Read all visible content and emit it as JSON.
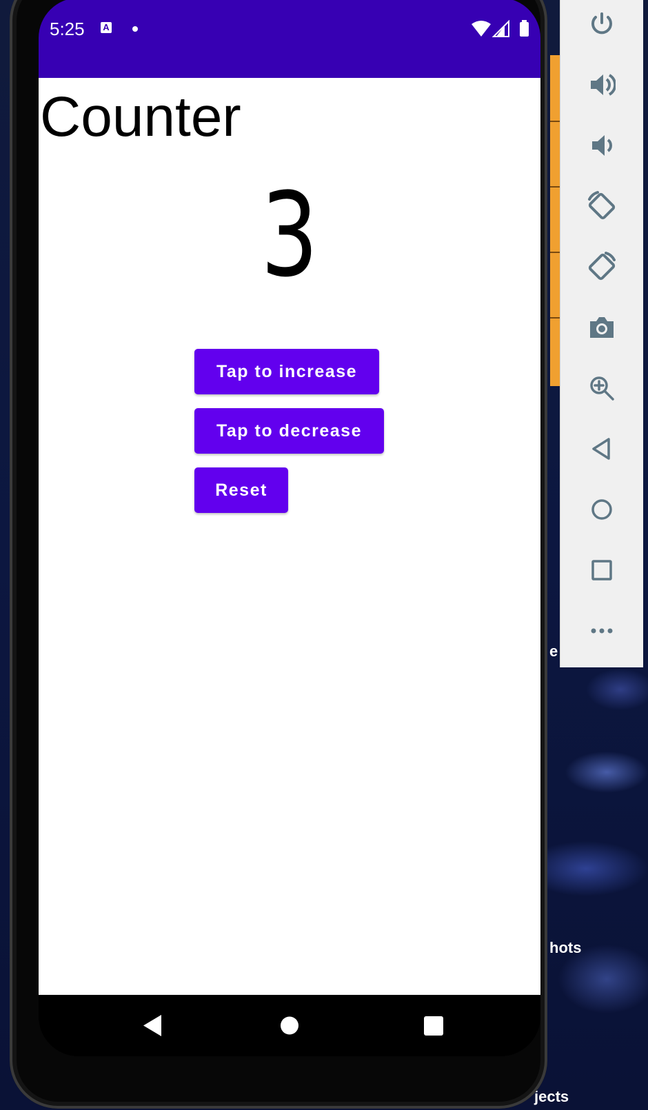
{
  "status_bar": {
    "time": "5:25",
    "notification_icon": "A",
    "icons": [
      "wifi-icon",
      "signal-icon",
      "battery-icon"
    ]
  },
  "app": {
    "title": "Counter",
    "count": "3",
    "buttons": {
      "increase": "Tap to increase",
      "decrease": "Tap to decrease",
      "reset": "Reset"
    }
  },
  "nav_bar": [
    "back-icon",
    "home-icon",
    "recents-icon"
  ],
  "emulator_toolbar": [
    "power-icon",
    "volume-up-icon",
    "volume-down-icon",
    "rotate-left-icon",
    "rotate-right-icon",
    "camera-icon",
    "zoom-icon",
    "back-icon",
    "home-icon",
    "overview-icon",
    "more-icon"
  ],
  "desktop_labels": [
    "e",
    "hots",
    "jects"
  ],
  "colors": {
    "status_bar": "#3700b3",
    "button": "#6200ee",
    "toolbar_icon": "#5f7785"
  }
}
